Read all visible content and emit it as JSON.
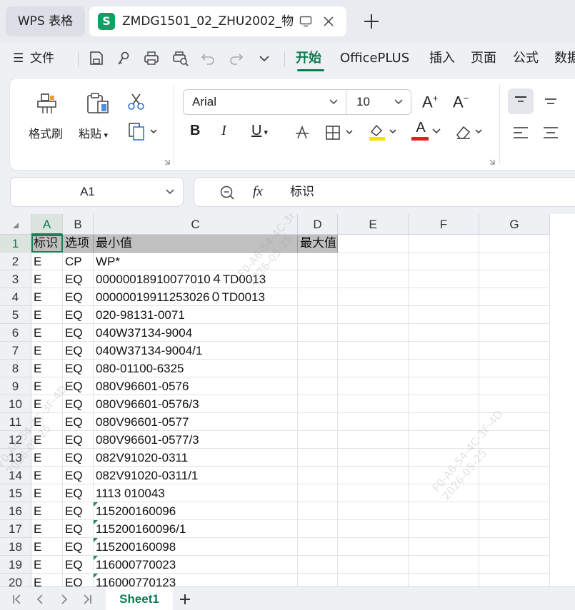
{
  "tabs": {
    "home_label": "WPS 表格",
    "doc_icon_letter": "S",
    "doc_title": "ZMDG1501_02_ZHU2002_物"
  },
  "menu": {
    "file_label": "文件",
    "tabs": [
      "开始",
      "OfficePLUS",
      "插入",
      "页面",
      "公式",
      "数据"
    ],
    "active_tab": "开始"
  },
  "ribbon": {
    "format_painter": "格式刷",
    "paste": "粘贴",
    "font_name": "Arial",
    "font_size": "10",
    "bold": "B",
    "italic": "I",
    "underline": "U",
    "grow_font": "A",
    "shrink_font": "A",
    "font_color_letter": "A",
    "accent": "#0d7a4f",
    "font_color": "#e02020",
    "fill_color": "#f5e000"
  },
  "formula_bar": {
    "cell_ref": "A1",
    "fx_label": "fx",
    "content": "标识"
  },
  "grid": {
    "columns": [
      "A",
      "B",
      "C",
      "D",
      "E",
      "F",
      "G"
    ],
    "selected_column": "A",
    "rows": [
      {
        "n": "1",
        "a": "标识",
        "b": "选项",
        "c": "最小值",
        "d": "最大值"
      },
      {
        "n": "2",
        "a": "E",
        "b": "CP",
        "c": "WP*",
        "d": ""
      },
      {
        "n": "3",
        "a": "E",
        "b": "EQ",
        "c": "00000018910077010４TD0013",
        "d": ""
      },
      {
        "n": "4",
        "a": "E",
        "b": "EQ",
        "c": "00000019911253026０TD0013",
        "d": ""
      },
      {
        "n": "5",
        "a": "E",
        "b": "EQ",
        "c": "020-98131-0071",
        "d": ""
      },
      {
        "n": "6",
        "a": "E",
        "b": "EQ",
        "c": "040W37134-9004",
        "d": ""
      },
      {
        "n": "7",
        "a": "E",
        "b": "EQ",
        "c": "040W37134-9004/1",
        "d": ""
      },
      {
        "n": "8",
        "a": "E",
        "b": "EQ",
        "c": "080-01100-6325",
        "d": ""
      },
      {
        "n": "9",
        "a": "E",
        "b": "EQ",
        "c": "080V96601-0576",
        "d": ""
      },
      {
        "n": "10",
        "a": "E",
        "b": "EQ",
        "c": "080V96601-0576/3",
        "d": ""
      },
      {
        "n": "11",
        "a": "E",
        "b": "EQ",
        "c": "080V96601-0577",
        "d": ""
      },
      {
        "n": "12",
        "a": "E",
        "b": "EQ",
        "c": "080V96601-0577/3",
        "d": ""
      },
      {
        "n": "13",
        "a": "E",
        "b": "EQ",
        "c": "082V91020-0311",
        "d": ""
      },
      {
        "n": "14",
        "a": "E",
        "b": "EQ",
        "c": "082V91020-0311/1",
        "d": ""
      },
      {
        "n": "15",
        "a": "E",
        "b": "EQ",
        "c": "1113  010043",
        "d": ""
      },
      {
        "n": "16",
        "a": "E",
        "b": "EQ",
        "c": "115200160096",
        "d": ""
      },
      {
        "n": "17",
        "a": "E",
        "b": "EQ",
        "c": "115200160096/1",
        "d": ""
      },
      {
        "n": "18",
        "a": "E",
        "b": "EQ",
        "c": "115200160098",
        "d": ""
      },
      {
        "n": "19",
        "a": "E",
        "b": "EQ",
        "c": "116000770023",
        "d": ""
      },
      {
        "n": "20",
        "a": "E",
        "b": "EQ",
        "c": "116000770123",
        "d": ""
      }
    ]
  },
  "watermarks": [
    {
      "line1": "F0-A6-54-4C-3F-4D",
      "line2": "2026-05-25"
    },
    {
      "line1": "F0-A6-54-4C-3F-4D",
      "line2": "2026-05-25"
    },
    {
      "line1": "F0-A6-54-4C-3F-4D",
      "line2": "2026-05-25"
    }
  ],
  "sheets": {
    "active": "Sheet1"
  }
}
